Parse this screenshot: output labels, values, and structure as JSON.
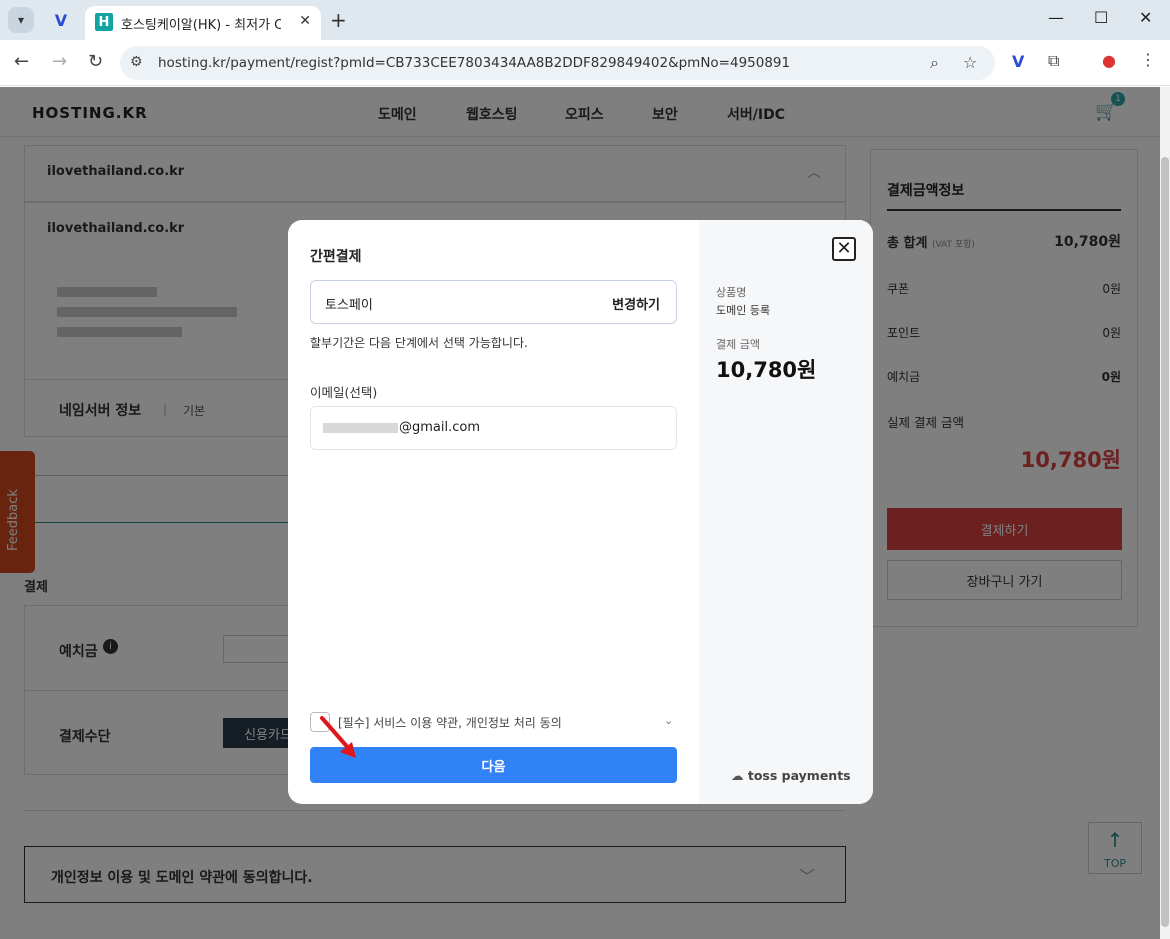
{
  "browser": {
    "tab_title": "호스팅케이알(HK) - 최저가 CO",
    "tab_favicon": "H",
    "url": "hosting.kr/payment/regist?pmId=CB733CEE7803434AA8B2DDF829849402&pmNo=4950891"
  },
  "site": {
    "logo": "HOSTING.KR",
    "menu": [
      "도메인",
      "웹호스팅",
      "오피스",
      "보안",
      "서버/IDC"
    ],
    "cart_count": "1"
  },
  "main": {
    "domain1": "ilovethailand.co.kr",
    "domain2": "ilovethailand.co.kr",
    "nameserver_label": "네임서버 정보",
    "nameserver_value": "기본",
    "payment_section": "결제",
    "deposit_label": "예치금",
    "payment_method_label": "결제수단",
    "credit_card": "신용카드",
    "agree_privacy": "개인정보 이용 및 도메인 약관에 동의합니다.",
    "feedback": "Feedback",
    "top": "TOP"
  },
  "summary": {
    "title": "결제금액정보",
    "total_label": "총 합계",
    "total_vat": "(VAT 포함)",
    "total_value": "10,780원",
    "coupon_label": "쿠폰",
    "coupon_value": "0원",
    "point_label": "포인트",
    "point_value": "0원",
    "deposit_label": "예치금",
    "deposit_value": "0원",
    "actual_label": "실제 결제 금액",
    "actual_value": "10,780원",
    "pay_button": "결제하기",
    "cart_button": "장바구니 가기"
  },
  "modal": {
    "title": "간편결제",
    "method": "토스페이",
    "change": "변경하기",
    "installment_note": "할부기간은 다음 단계에서 선택 가능합니다.",
    "email_label": "이메일(선택)",
    "email_suffix": "@gmail.com",
    "agree_text": "[필수] 서비스 이용 약관, 개인정보 처리 동의",
    "next_button": "다음",
    "product_label": "상품명",
    "product_value": "도메인 등록",
    "amount_label": "결제 금액",
    "amount_value": "10,780원",
    "brand": "toss payments"
  },
  "colors": {
    "toss_blue": "#3182f6",
    "pay_red": "#d8403f",
    "feedback_orange": "#d2491f"
  }
}
